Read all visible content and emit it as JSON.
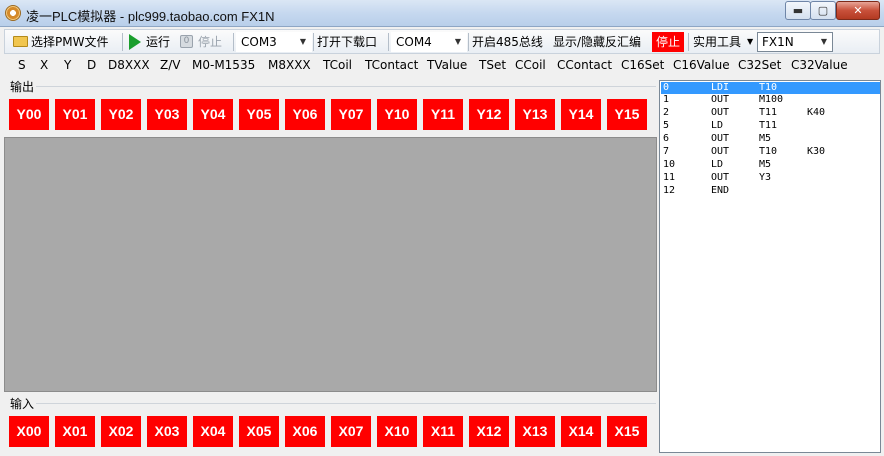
{
  "window": {
    "title": "凌一PLC模拟器 - plc999.taobao.com  FX1N",
    "minimize_label": "▬",
    "maximize_label": "▢",
    "close_label": "✕"
  },
  "toolbar": {
    "choose_file": "选择PMW文件",
    "run": "运行",
    "stop_disabled": "停止",
    "com_port": "COM3",
    "open_download": "打开下载口",
    "com_port2": "COM4",
    "open_485": "开启485总线",
    "toggle_decompile": "显示/隐藏反汇编",
    "stop_active": "停止",
    "tools": "实用工具",
    "model": "FX1N",
    "stop_active_color": "#ff0000"
  },
  "menu": [
    "S",
    "X",
    "Y",
    "D",
    "D8XXX",
    "Z/V",
    "M0-M1535",
    "M8XXX",
    "TCoil",
    "TContact",
    "TValue",
    "TSet",
    "CCoil",
    "CContact",
    "C16Set",
    "C16Value",
    "C32Set",
    "C32Value"
  ],
  "output": {
    "label": "输出",
    "cells": [
      "Y00",
      "Y01",
      "Y02",
      "Y03",
      "Y04",
      "Y05",
      "Y06",
      "Y07",
      "Y10",
      "Y11",
      "Y12",
      "Y13",
      "Y14",
      "Y15"
    ],
    "color": "#ff0000"
  },
  "input": {
    "label": "输入",
    "cells": [
      "X00",
      "X01",
      "X02",
      "X03",
      "X04",
      "X05",
      "X06",
      "X07",
      "X10",
      "X11",
      "X12",
      "X13",
      "X14",
      "X15"
    ],
    "color": "#ff0000"
  },
  "listing": {
    "selected_index": 0,
    "rows": [
      {
        "step": "0",
        "op": "LDI",
        "arg": "T10",
        "arg2": ""
      },
      {
        "step": "1",
        "op": "OUT",
        "arg": "M100",
        "arg2": ""
      },
      {
        "step": "2",
        "op": "OUT",
        "arg": "T11",
        "arg2": "K40"
      },
      {
        "step": "5",
        "op": "LD",
        "arg": "T11",
        "arg2": ""
      },
      {
        "step": "6",
        "op": "OUT",
        "arg": "M5",
        "arg2": ""
      },
      {
        "step": "7",
        "op": "OUT",
        "arg": "T10",
        "arg2": "K30"
      },
      {
        "step": "10",
        "op": "LD",
        "arg": "M5",
        "arg2": ""
      },
      {
        "step": "11",
        "op": "OUT",
        "arg": "Y3",
        "arg2": ""
      },
      {
        "step": "12",
        "op": "END",
        "arg": "",
        "arg2": ""
      }
    ]
  }
}
